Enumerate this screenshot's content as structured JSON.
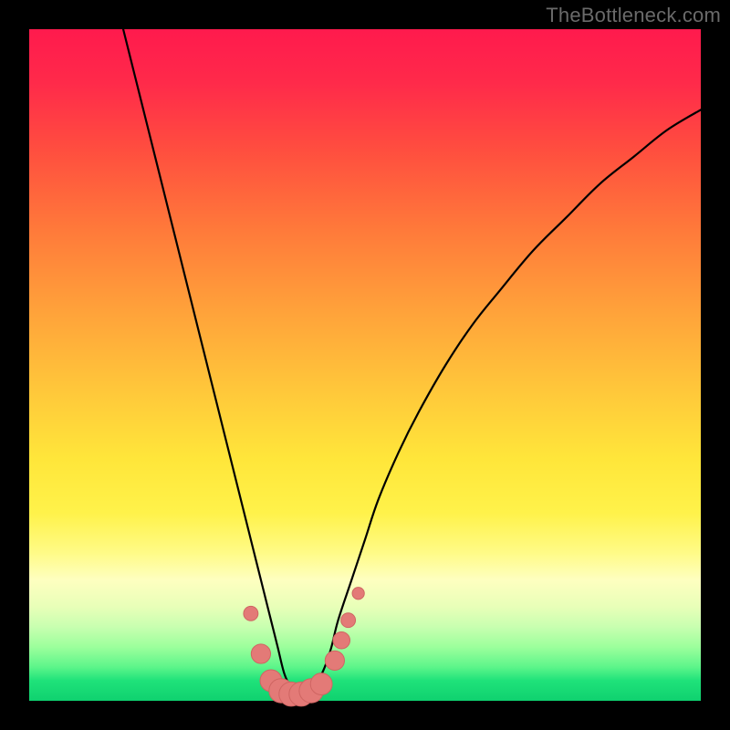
{
  "watermark": "TheBottleneck.com",
  "colors": {
    "background": "#000000",
    "curve": "#000000",
    "marker_fill": "#e37a77",
    "marker_stroke": "#cf6562"
  },
  "chart_data": {
    "type": "line",
    "title": "",
    "xlabel": "",
    "ylabel": "",
    "xlim": [
      0,
      100
    ],
    "ylim": [
      0,
      100
    ],
    "grid": false,
    "legend": false,
    "series": [
      {
        "name": "bottleneck-curve",
        "x": [
          14,
          16,
          18,
          20,
          22,
          24,
          26,
          28,
          30,
          32,
          33,
          34,
          35,
          36,
          37,
          38,
          39,
          40,
          41,
          42,
          43,
          44,
          45,
          46,
          48,
          50,
          52,
          55,
          58,
          62,
          66,
          70,
          75,
          80,
          85,
          90,
          95,
          100
        ],
        "y": [
          100,
          92,
          84,
          76,
          68,
          60,
          52,
          44,
          36,
          28,
          24,
          20,
          16,
          12,
          8,
          4,
          2,
          1,
          1,
          2,
          3,
          5,
          8,
          12,
          18,
          24,
          30,
          37,
          43,
          50,
          56,
          61,
          67,
          72,
          77,
          81,
          85,
          88
        ]
      }
    ],
    "markers": [
      {
        "x": 33.0,
        "y": 13.0,
        "r": 1.2
      },
      {
        "x": 34.5,
        "y": 7.0,
        "r": 1.6
      },
      {
        "x": 36.0,
        "y": 3.0,
        "r": 1.8
      },
      {
        "x": 37.5,
        "y": 1.5,
        "r": 2.0
      },
      {
        "x": 39.0,
        "y": 1.0,
        "r": 2.0
      },
      {
        "x": 40.5,
        "y": 1.0,
        "r": 2.0
      },
      {
        "x": 42.0,
        "y": 1.5,
        "r": 2.0
      },
      {
        "x": 43.5,
        "y": 2.5,
        "r": 1.8
      },
      {
        "x": 45.5,
        "y": 6.0,
        "r": 1.6
      },
      {
        "x": 46.5,
        "y": 9.0,
        "r": 1.4
      },
      {
        "x": 47.5,
        "y": 12.0,
        "r": 1.2
      },
      {
        "x": 49.0,
        "y": 16.0,
        "r": 1.0
      }
    ]
  }
}
